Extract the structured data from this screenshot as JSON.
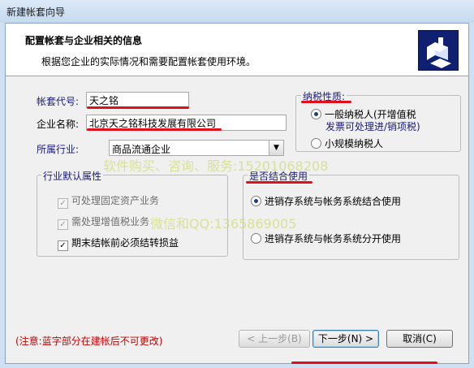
{
  "window": {
    "title": "新建帐套向导"
  },
  "header": {
    "title": "配置帐套与企业相关的信息",
    "subtitle": "根据您企业的实际情况和需要配置帐套使用环境。",
    "logo": "wizard-logo-icon"
  },
  "form": {
    "account_code_label": "帐套代号:",
    "account_code_value": "天之铭",
    "company_name_label": "企业名称:",
    "company_name_value": "北京天之铭科技发展有限公司",
    "industry_label": "所属行业:",
    "industry_value": "商品流通企业"
  },
  "tax": {
    "title": "纳税性质:",
    "general_line1": "一般纳税人(开增值税",
    "general_line2": "发票可处理进/销项税)",
    "small": "小规模纳税人",
    "selected": "general"
  },
  "industry_defaults": {
    "title": "行业默认属性",
    "options": [
      {
        "label": "可处理固定资产业务",
        "checked": true,
        "disabled": true
      },
      {
        "label": "需处理增值税业务",
        "checked": true,
        "disabled": true
      },
      {
        "label": "期末结帐前必须结转损益",
        "checked": true,
        "disabled": false
      }
    ]
  },
  "combine": {
    "title": "是否结合使用",
    "option_combine": "进销存系统与帐务系统结合使用",
    "option_separate": "进销存系统与帐务系统分开使用",
    "selected": "combine"
  },
  "footer": {
    "note": "(注意:蓝字部分在建帐后不可更改)",
    "prev_label": "< 上一步(B)",
    "next_label": "下一步(N) >",
    "cancel_label": "取消(C)"
  },
  "watermarks": {
    "line1": "软件购买、咨询、服务:15201068208",
    "line2": "微信和QQ:1365869005"
  },
  "colors": {
    "annotation_red": "#e0101a",
    "label_blue": "#1a1a7a",
    "note_red": "#c00000"
  }
}
